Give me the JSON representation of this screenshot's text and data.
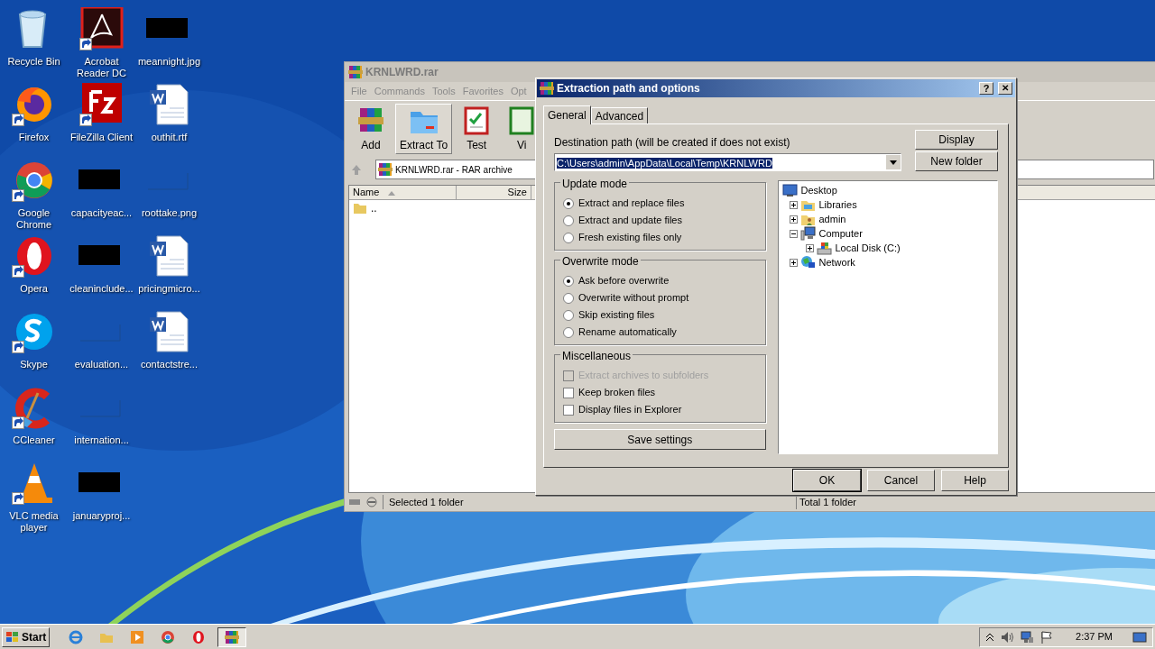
{
  "desktop_icons": [
    {
      "label": "Recycle Bin",
      "kind": "recycle",
      "shortcut": false
    },
    {
      "label": "Firefox",
      "kind": "firefox",
      "shortcut": true
    },
    {
      "label": "Google Chrome",
      "kind": "chrome",
      "shortcut": true
    },
    {
      "label": "Opera",
      "kind": "opera",
      "shortcut": true
    },
    {
      "label": "Skype",
      "kind": "skype",
      "shortcut": true
    },
    {
      "label": "CCleaner",
      "kind": "ccleaner",
      "shortcut": true
    },
    {
      "label": "VLC media player",
      "kind": "vlc",
      "shortcut": true
    },
    {
      "label": "Acrobat Reader DC",
      "kind": "acrobat",
      "shortcut": true
    },
    {
      "label": "FileZilla Client",
      "kind": "filezilla",
      "shortcut": true
    },
    {
      "label": "capacityeac...",
      "kind": "redacted",
      "shortcut": false
    },
    {
      "label": "cleaninclude...",
      "kind": "redacted",
      "shortcut": false
    },
    {
      "label": "evaluation...",
      "kind": "blank",
      "shortcut": false
    },
    {
      "label": "internation...",
      "kind": "blank",
      "shortcut": false
    },
    {
      "label": "januaryproj...",
      "kind": "redacted",
      "shortcut": false
    },
    {
      "label": "meannight.jpg",
      "kind": "redacted",
      "shortcut": false
    },
    {
      "label": "outhit.rtf",
      "kind": "word",
      "shortcut": false
    },
    {
      "label": "roottake.png",
      "kind": "blank",
      "shortcut": false
    },
    {
      "label": "pricingmicro...",
      "kind": "word",
      "shortcut": false
    },
    {
      "label": "contactstre...",
      "kind": "word",
      "shortcut": false
    }
  ],
  "archive_window": {
    "title": "KRNLWRD.rar",
    "menu": [
      "File",
      "Commands",
      "Tools",
      "Favorites",
      "Opt"
    ],
    "toolbar": [
      {
        "label": "Add",
        "kind": "add",
        "selected": false
      },
      {
        "label": "Extract To",
        "kind": "extract",
        "selected": true
      },
      {
        "label": "Test",
        "kind": "test",
        "selected": false
      },
      {
        "label": "Vi",
        "kind": "view",
        "selected": false
      }
    ],
    "address": "KRNLWRD.rar - RAR archive",
    "columns": [
      "Name",
      "Size"
    ],
    "rows": [
      ".."
    ],
    "status_left": "Selected 1 folder",
    "status_right": "Total 1 folder"
  },
  "dialog": {
    "title": "Extraction path and options",
    "help_button": "?",
    "close_button": "✕",
    "tabs": [
      {
        "label": "General",
        "selected": true
      },
      {
        "label": "Advanced",
        "selected": false
      }
    ],
    "destination_label": "Destination path (will be created if does not exist)",
    "destination_value": "C:\\Users\\admin\\AppData\\Local\\Temp\\KRNLWRD",
    "side_buttons": [
      "Display",
      "New folder"
    ],
    "groups": [
      {
        "title": "Update mode",
        "items": [
          {
            "kind": "radio",
            "label": "Extract and replace files",
            "selected": true,
            "disabled": false
          },
          {
            "kind": "radio",
            "label": "Extract and update files",
            "selected": false,
            "disabled": false
          },
          {
            "kind": "radio",
            "label": "Fresh existing files only",
            "selected": false,
            "disabled": false
          }
        ]
      },
      {
        "title": "Overwrite mode",
        "items": [
          {
            "kind": "radio",
            "label": "Ask before overwrite",
            "selected": true,
            "disabled": false
          },
          {
            "kind": "radio",
            "label": "Overwrite without prompt",
            "selected": false,
            "disabled": false
          },
          {
            "kind": "radio",
            "label": "Skip existing files",
            "selected": false,
            "disabled": false
          },
          {
            "kind": "radio",
            "label": "Rename automatically",
            "selected": false,
            "disabled": false
          }
        ]
      },
      {
        "title": "Miscellaneous",
        "items": [
          {
            "kind": "checkbox",
            "label": "Extract archives to subfolders",
            "checked": false,
            "disabled": true
          },
          {
            "kind": "checkbox",
            "label": "Keep broken files",
            "checked": false,
            "disabled": false
          },
          {
            "kind": "checkbox",
            "label": "Display files in Explorer",
            "checked": false,
            "disabled": false
          }
        ]
      }
    ],
    "save_button": "Save settings",
    "tree": [
      {
        "label": "Desktop",
        "kind": "desktop",
        "children": [
          {
            "label": "Libraries",
            "kind": "library",
            "expanded": false
          },
          {
            "label": "admin",
            "kind": "user",
            "expanded": false
          },
          {
            "label": "Computer",
            "kind": "computer",
            "expanded": true,
            "children": [
              {
                "label": "Local Disk (C:)",
                "kind": "disk",
                "expanded": false
              }
            ]
          },
          {
            "label": "Network",
            "kind": "network",
            "expanded": false
          }
        ]
      }
    ],
    "buttons": [
      {
        "label": "OK",
        "default": true
      },
      {
        "label": "Cancel",
        "default": false
      },
      {
        "label": "Help",
        "default": false
      }
    ]
  },
  "taskbar": {
    "start": "Start",
    "apps": [
      {
        "kind": "ie",
        "active": false
      },
      {
        "kind": "explorer",
        "active": false
      },
      {
        "kind": "media",
        "active": false
      },
      {
        "kind": "chrome",
        "active": false
      },
      {
        "kind": "opera",
        "active": false
      },
      {
        "kind": "winrar",
        "active": true
      }
    ],
    "time": "2:37 PM"
  }
}
